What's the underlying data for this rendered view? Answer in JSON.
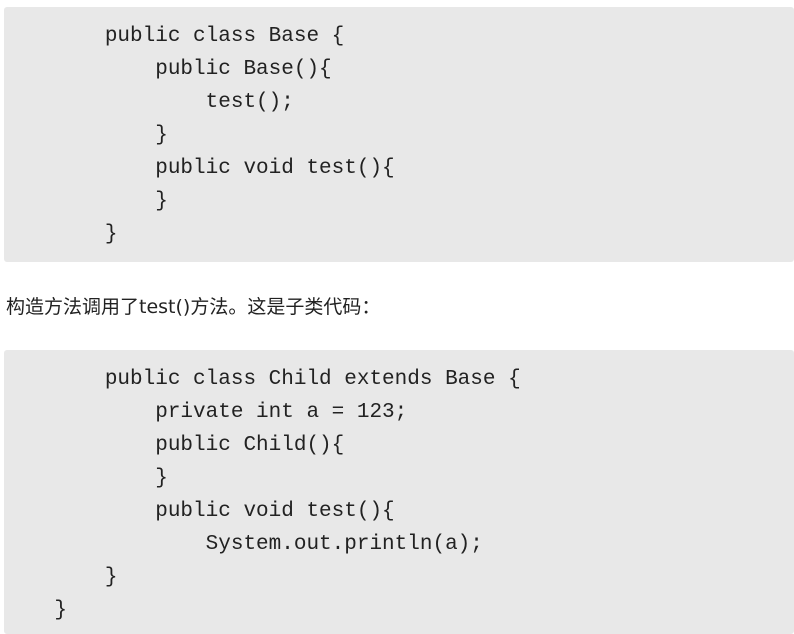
{
  "code_block_1": {
    "lines": [
      "        public class Base {",
      "            public Base(){",
      "                test();",
      "            }",
      "            public void test(){",
      "            }",
      "        }"
    ]
  },
  "paragraph": {
    "text": "构造方法调用了test()方法。这是子类代码："
  },
  "code_block_2": {
    "lines": [
      "        public class Child extends Base {",
      "            private int a = 123;",
      "            public Child(){",
      "            }",
      "            public void test(){",
      "                System.out.println(a);",
      "        }",
      "    }"
    ]
  }
}
